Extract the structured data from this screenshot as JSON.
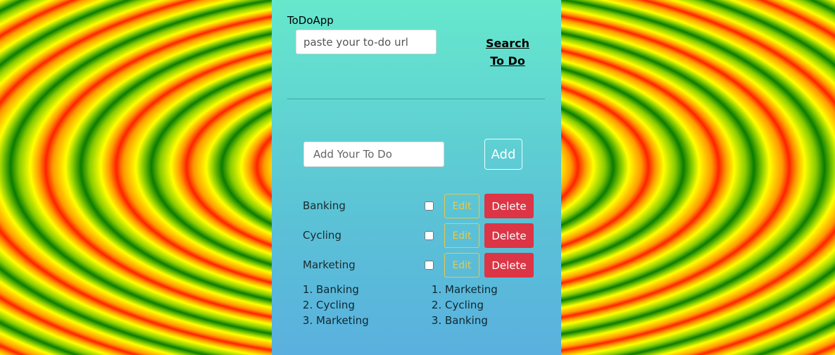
{
  "app": {
    "title": "ToDoApp"
  },
  "search": {
    "placeholder": "paste your to-do url",
    "link_line1": "Search",
    "link_line2": "To Do"
  },
  "add": {
    "placeholder": "Add Your To Do",
    "button_label": "Add"
  },
  "todos": [
    {
      "label": "Banking",
      "checked": false,
      "edit_label": "Edit",
      "delete_label": "Delete"
    },
    {
      "label": "Cycling",
      "checked": false,
      "edit_label": "Edit",
      "delete_label": "Delete"
    },
    {
      "label": "Marketing",
      "checked": false,
      "edit_label": "Edit",
      "delete_label": "Delete"
    }
  ],
  "list_a": [
    "Banking",
    "Cycling",
    "Marketing"
  ],
  "list_b": [
    "Marketing",
    "Cycling",
    "Banking"
  ],
  "colors": {
    "delete": "#dc3545",
    "edit": "#f0c63a",
    "panel_top": "#66e8cc",
    "panel_bottom": "#5ab0de"
  }
}
